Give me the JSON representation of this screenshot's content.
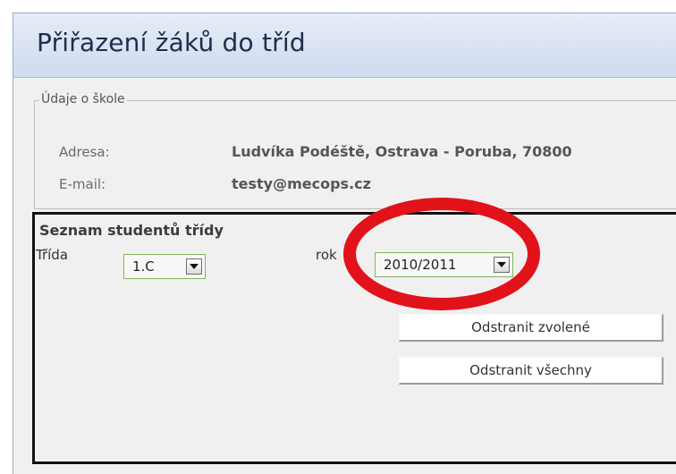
{
  "page_title": "Přiřazení žáků do tříd",
  "school_info": {
    "legend": "Údaje o škole",
    "address_label": "Adresa:",
    "address_value": "Ludvíka Podéště, Ostrava - Poruba, 70800",
    "email_label": "E-mail:",
    "email_value": "testy@mecops.cz"
  },
  "students": {
    "title": "Seznam studentů třídy",
    "class_label": "Třída",
    "class_value": "1.C",
    "year_label": "rok",
    "year_value": "2010/2011",
    "remove_selected_label": "Odstranit zvolené",
    "remove_all_label": "Odstranit všechny"
  },
  "colors": {
    "annotation": "#e2121b",
    "select_border": "#84b55e",
    "title_bar": "#cfdbef"
  }
}
